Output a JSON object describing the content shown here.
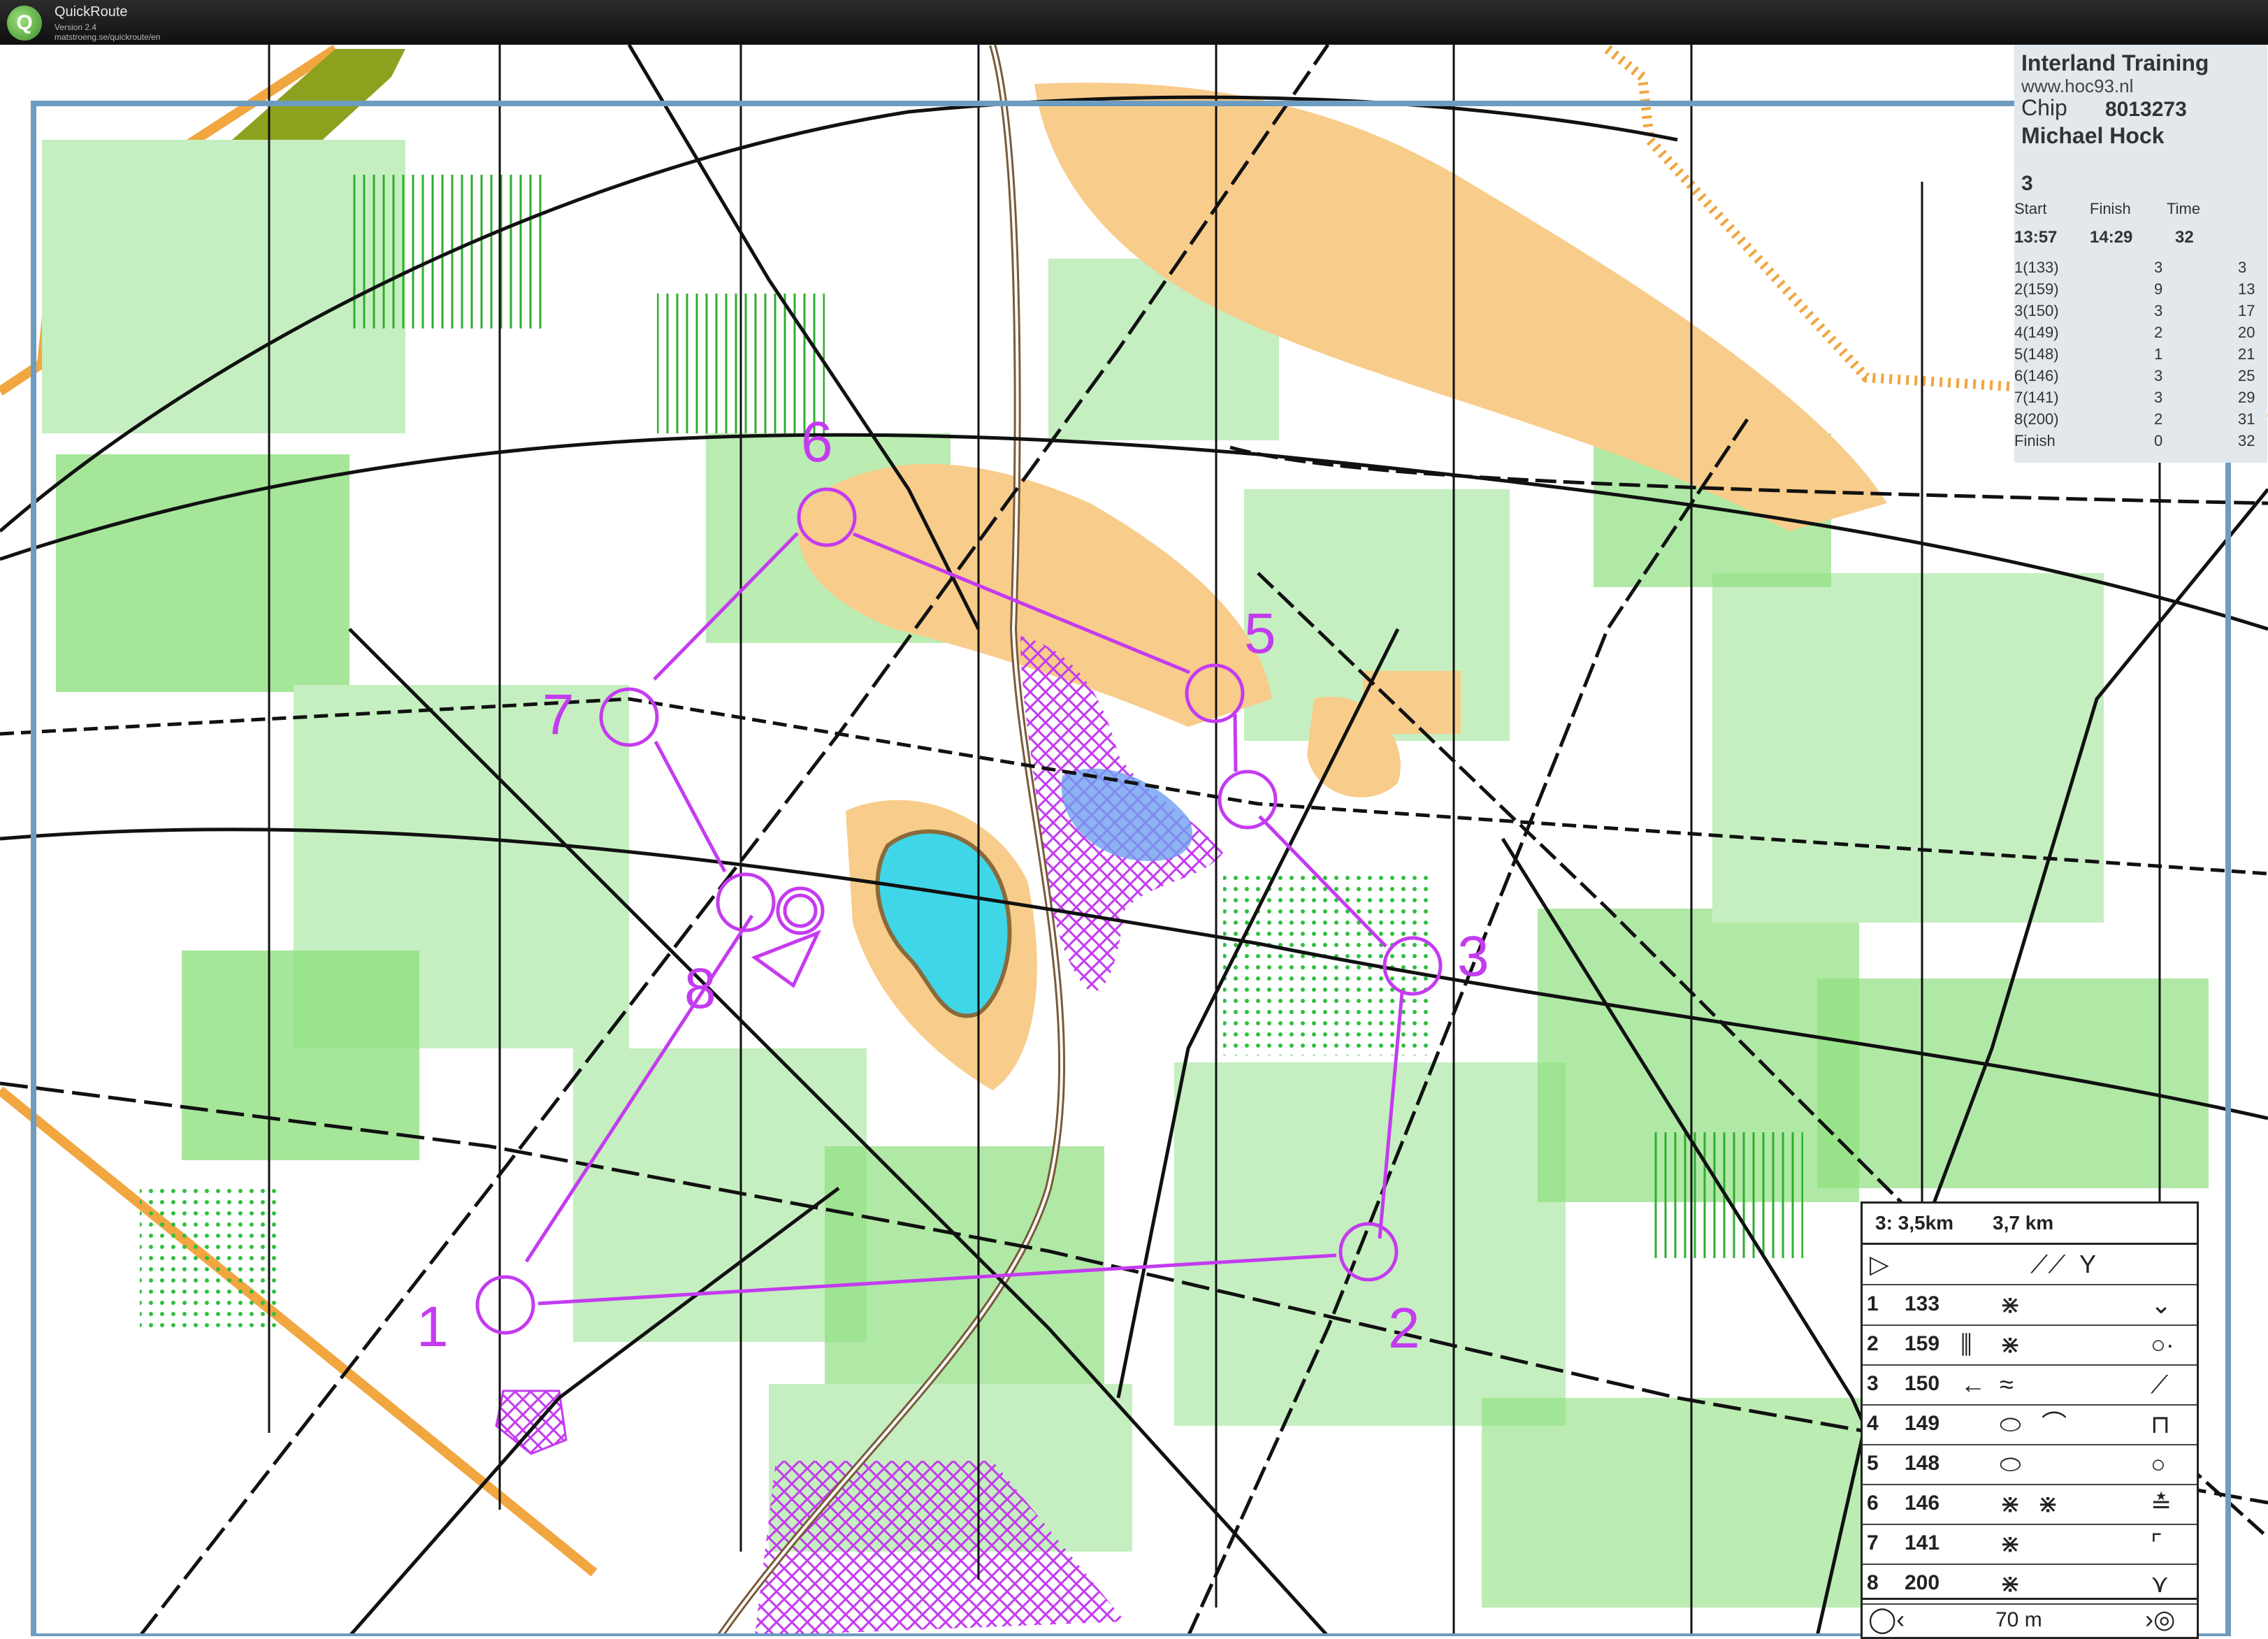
{
  "app": {
    "name": "QuickRoute",
    "version": "Version 2.4",
    "url": "matstroeng.se/quickroute/en",
    "logo_letter": "Q"
  },
  "colors": {
    "forest_white": "#ffffff",
    "green_light": "#c5efc0",
    "green_mid": "#8ee07f",
    "green_dark": "#3ecb2e",
    "open_yellow": "#f8cc8a",
    "lake": "#3fd6e8",
    "purple_course": "#c43bf0",
    "border_blue": "#6e9cc0",
    "olive": "#8ea11e",
    "orange_out": "#f1a640"
  },
  "controls": [
    {
      "label": "1"
    },
    {
      "label": "2"
    },
    {
      "label": "3"
    },
    {
      "label": "5"
    },
    {
      "label": "6"
    },
    {
      "label": "7"
    },
    {
      "label": "8"
    }
  ],
  "result_card": {
    "title": "Interland Training",
    "website": "www.hoc93.nl",
    "chip_label": "Chip",
    "chip_number": "8013273",
    "runner": "Michael Hock",
    "course": "3",
    "start_label": "Start",
    "finish_label": "Finish",
    "time_label": "Time",
    "start_value": "13:57",
    "finish_value": "14:29",
    "time_value": "32",
    "splits": [
      {
        "control": "1(133)",
        "split": "3",
        "total": "3"
      },
      {
        "control": "2(159)",
        "split": "9",
        "total": "13"
      },
      {
        "control": "3(150)",
        "split": "3",
        "total": "17"
      },
      {
        "control": "4(149)",
        "split": "2",
        "total": "20"
      },
      {
        "control": "5(148)",
        "split": "1",
        "total": "21"
      },
      {
        "control": "6(146)",
        "split": "3",
        "total": "25"
      },
      {
        "control": "7(141)",
        "split": "3",
        "total": "29"
      },
      {
        "control": "8(200)",
        "split": "2",
        "total": "31"
      },
      {
        "control": "Finish",
        "split": "0",
        "total": "32"
      }
    ]
  },
  "description_sheet": {
    "course_length": "3: 3,5km",
    "total_length": "3,7 km",
    "start_symbol": "triangle",
    "rows": [
      {
        "num": "1",
        "code": "133"
      },
      {
        "num": "2",
        "code": "159"
      },
      {
        "num": "3",
        "code": "150"
      },
      {
        "num": "4",
        "code": "149"
      },
      {
        "num": "5",
        "code": "148"
      },
      {
        "num": "6",
        "code": "146"
      },
      {
        "num": "7",
        "code": "141"
      },
      {
        "num": "8",
        "code": "200"
      }
    ],
    "finish_distance": "70 m"
  }
}
